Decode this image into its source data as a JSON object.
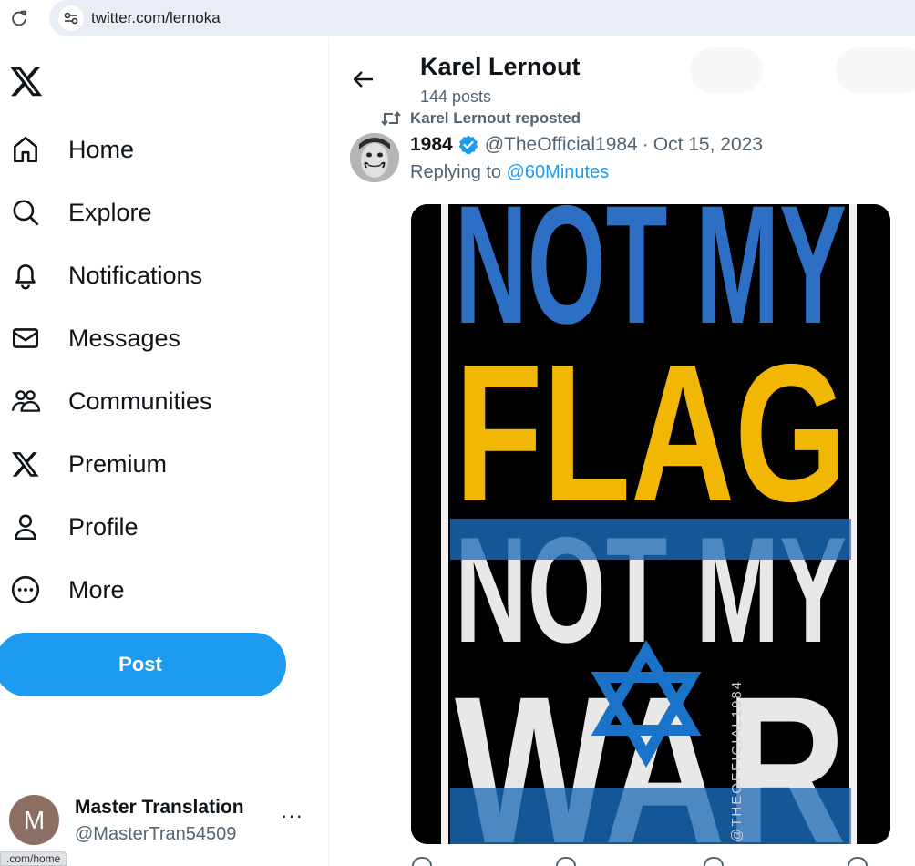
{
  "browser": {
    "url": "twitter.com/lernoka"
  },
  "nav": {
    "items": [
      {
        "label": "Home",
        "icon": "home-icon"
      },
      {
        "label": "Explore",
        "icon": "search-icon"
      },
      {
        "label": "Notifications",
        "icon": "bell-icon"
      },
      {
        "label": "Messages",
        "icon": "envelope-icon"
      },
      {
        "label": "Communities",
        "icon": "people-icon"
      },
      {
        "label": "Premium",
        "icon": "x-logo-icon"
      },
      {
        "label": "Profile",
        "icon": "person-icon"
      },
      {
        "label": "More",
        "icon": "more-circle-icon"
      }
    ],
    "post_label": "Post"
  },
  "account": {
    "avatar_letter": "M",
    "name": "Master Translation",
    "handle": "@MasterTran54509",
    "more": "···"
  },
  "status_tooltip": ".com/home",
  "header": {
    "name": "Karel Lernout",
    "post_count": "144 posts"
  },
  "tweet": {
    "repost_text": "Karel Lernout reposted",
    "author_name": "1984",
    "author_handle": "@TheOfficial1984",
    "separator": "·",
    "date": "Oct 15, 2023",
    "replying_prefix": "Replying to ",
    "replying_to": "@60Minutes",
    "image": {
      "lines": [
        "NOT MY",
        "FLAG",
        "NOT MY",
        "WAR"
      ],
      "watermark": "@THEOFFICIAL1984"
    }
  },
  "colors": {
    "accent": "#1d9bf0",
    "muted_text": "#536471",
    "primary_text": "#0f1419",
    "ukraine_blue": "#2d6fc4",
    "ukraine_yellow": "#f2b705",
    "israel_blue": "#1a73c8"
  }
}
